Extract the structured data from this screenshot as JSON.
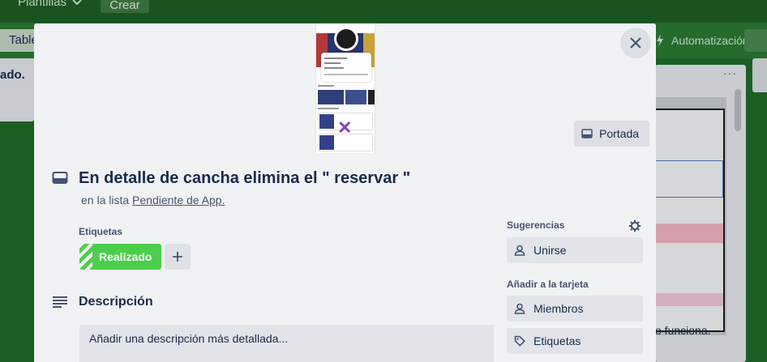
{
  "background": {
    "menu_plantillas": "Plantillas",
    "menu_crear": "Crear",
    "view_label": "Table",
    "automation_label": "Automatización",
    "left_card_text": "ado.",
    "right_card_text": "o funciona.",
    "list_menu": "···"
  },
  "modal": {
    "cover_button": "Portada",
    "title": "En detalle de cancha elimina el \" reservar \"",
    "in_list_prefix": "en la lista",
    "list_name": "Pendiente de App.",
    "labels_heading": "Etiquetas",
    "label_chip": "Realizado",
    "description_heading": "Descripción",
    "description_placeholder": "Añadir una descripción más detallada...",
    "suggestions_heading": "Sugerencias",
    "join_button": "Unirse",
    "add_to_card_heading": "Añadir a la tarjeta",
    "members_button": "Miembros",
    "labels_button": "Etiquetas"
  },
  "colors": {
    "board_bg": "#1f6b2a",
    "label_green": "#4bce4b",
    "modal_bg": "#f1f2f4"
  },
  "icons": [
    "chevron-down-icon",
    "lightning-icon",
    "close-icon",
    "card-icon",
    "plus-icon",
    "description-icon",
    "gear-icon",
    "person-icon",
    "tag-icon"
  ]
}
